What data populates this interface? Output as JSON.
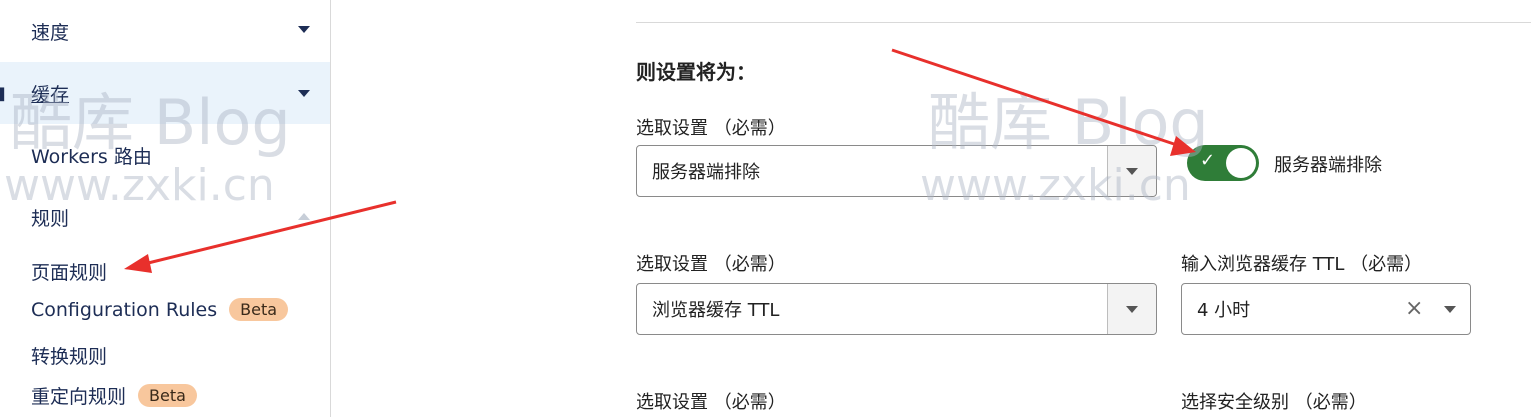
{
  "sidebar": {
    "items": [
      {
        "label": "速度"
      },
      {
        "label": "缓存"
      },
      {
        "label": "Workers 路由"
      },
      {
        "label": "规则"
      }
    ],
    "rules_children": [
      {
        "label": "页面规则"
      },
      {
        "label": "Configuration Rules",
        "badge": "Beta"
      },
      {
        "label": "转换规则"
      },
      {
        "label": "重定向规则",
        "badge": "Beta"
      }
    ]
  },
  "main": {
    "heading": "则设置将为：",
    "setting1": {
      "label": "选取设置 （必需）",
      "value": "服务器端排除",
      "toggle_label": "服务器端排除",
      "toggle_on": true
    },
    "setting2": {
      "label": "选取设置 （必需）",
      "value": "浏览器缓存 TTL",
      "ttl_label": "输入浏览器缓存 TTL （必需）",
      "ttl_value": "4 小时",
      "clear_symbol": "×"
    },
    "setting3": {
      "label": "选取设置 （必需）",
      "security_label": "选择安全级别 （必需）"
    }
  },
  "watermark": {
    "brand": "酷库 Blog",
    "url": "www.zxki.cn"
  },
  "colors": {
    "toggle_on": "#2f7d38",
    "annotation_arrow": "#e8302c",
    "badge": "#f8c79d"
  }
}
